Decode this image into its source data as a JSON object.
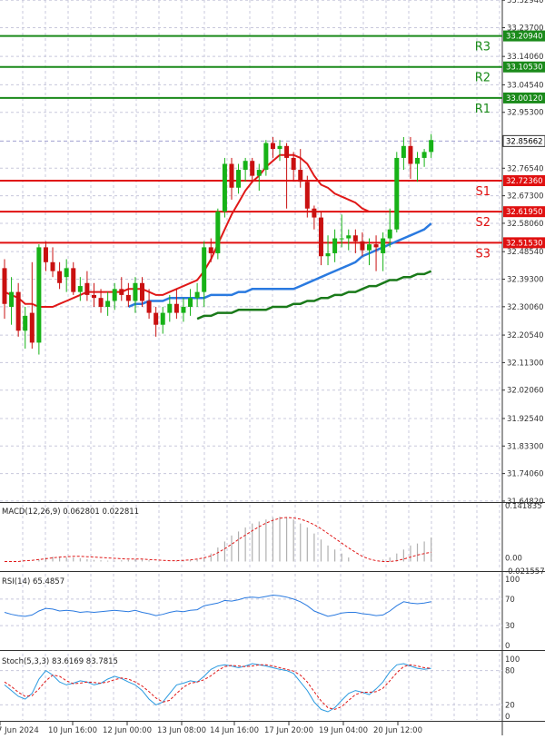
{
  "chart_data": {
    "type": "candlestick",
    "main": {
      "y_ticks": [
        "33.32940",
        "33.23700",
        "33.14060",
        "33.04540",
        "32.95300",
        "32.76540",
        "32.67300",
        "32.58060",
        "32.48540",
        "32.39300",
        "32.30060",
        "32.20540",
        "32.11300",
        "32.02060",
        "31.92540",
        "31.83300",
        "31.74060",
        "31.64820"
      ],
      "ylim": [
        31.648,
        33.33
      ],
      "current_price": "32.85662",
      "levels": [
        {
          "name": "R3",
          "value": 33.2094,
          "label": "33.20940",
          "color": "#1a8a1a"
        },
        {
          "name": "R2",
          "value": 33.1053,
          "label": "33.10530",
          "color": "#1a8a1a"
        },
        {
          "name": "R1",
          "value": 33.0012,
          "label": "33.00120",
          "color": "#1a8a1a"
        },
        {
          "name": "S1",
          "value": 32.7236,
          "label": "32.72360",
          "color": "#e01010"
        },
        {
          "name": "S2",
          "value": 32.6195,
          "label": "32.61950",
          "color": "#e01010"
        },
        {
          "name": "S3",
          "value": 32.5153,
          "label": "32.51530",
          "color": "#e01010"
        }
      ],
      "candles": [
        [
          32.43,
          32.46,
          32.26,
          32.31
        ],
        [
          32.3,
          32.4,
          32.24,
          32.35
        ],
        [
          32.35,
          32.38,
          32.2,
          32.22
        ],
        [
          32.22,
          32.3,
          32.16,
          32.27
        ],
        [
          32.28,
          32.45,
          32.16,
          32.18
        ],
        [
          32.18,
          32.51,
          32.14,
          32.5
        ],
        [
          32.5,
          32.52,
          32.42,
          32.45
        ],
        [
          32.45,
          32.5,
          32.4,
          32.42
        ],
        [
          32.42,
          32.45,
          32.36,
          32.38
        ],
        [
          32.4,
          32.46,
          32.35,
          32.43
        ],
        [
          32.43,
          32.45,
          32.34,
          32.35
        ],
        [
          32.35,
          32.4,
          32.32,
          32.37
        ],
        [
          32.38,
          32.42,
          32.32,
          32.34
        ],
        [
          32.34,
          32.38,
          32.3,
          32.33
        ],
        [
          32.33,
          32.36,
          32.28,
          32.3
        ],
        [
          32.3,
          32.35,
          32.27,
          32.32
        ],
        [
          32.32,
          32.38,
          32.29,
          32.36
        ],
        [
          32.36,
          32.4,
          32.32,
          32.34
        ],
        [
          32.34,
          32.38,
          32.3,
          32.32
        ],
        [
          32.32,
          32.4,
          32.28,
          32.38
        ],
        [
          32.38,
          32.4,
          32.3,
          32.32
        ],
        [
          32.32,
          32.36,
          32.26,
          32.28
        ],
        [
          32.28,
          32.3,
          32.2,
          32.24
        ],
        [
          32.24,
          32.3,
          32.21,
          32.28
        ],
        [
          32.28,
          32.34,
          32.25,
          32.31
        ],
        [
          32.31,
          32.36,
          32.26,
          32.28
        ],
        [
          32.28,
          32.33,
          32.25,
          32.3
        ],
        [
          32.3,
          32.36,
          32.27,
          32.33
        ],
        [
          32.33,
          32.38,
          32.3,
          32.35
        ],
        [
          32.35,
          32.52,
          32.3,
          32.5
        ],
        [
          32.5,
          32.53,
          32.45,
          32.48
        ],
        [
          32.48,
          32.63,
          32.46,
          32.62
        ],
        [
          32.62,
          32.8,
          32.6,
          32.78
        ],
        [
          32.78,
          32.8,
          32.66,
          32.7
        ],
        [
          32.7,
          32.78,
          32.68,
          32.76
        ],
        [
          32.76,
          32.8,
          32.72,
          32.79
        ],
        [
          32.79,
          32.8,
          32.72,
          32.74
        ],
        [
          32.74,
          32.78,
          32.69,
          32.76
        ],
        [
          32.76,
          32.86,
          32.74,
          32.85
        ],
        [
          32.85,
          32.87,
          32.8,
          32.83
        ],
        [
          32.83,
          32.86,
          32.79,
          32.84
        ],
        [
          32.84,
          32.85,
          32.63,
          32.8
        ],
        [
          32.8,
          32.82,
          32.72,
          32.76
        ],
        [
          32.76,
          32.83,
          32.7,
          32.72
        ],
        [
          32.72,
          32.74,
          32.6,
          32.63
        ],
        [
          32.63,
          32.64,
          32.56,
          32.6
        ],
        [
          32.6,
          32.62,
          32.44,
          32.47
        ],
        [
          32.47,
          32.54,
          32.44,
          32.48
        ],
        [
          32.48,
          32.56,
          32.45,
          32.53
        ],
        [
          32.53,
          32.61,
          32.5,
          32.53
        ],
        [
          32.53,
          32.56,
          32.49,
          32.54
        ],
        [
          32.54,
          32.56,
          32.48,
          32.52
        ],
        [
          32.52,
          32.55,
          32.47,
          32.49
        ],
        [
          32.49,
          32.53,
          32.44,
          32.51
        ],
        [
          32.51,
          32.54,
          32.42,
          32.5
        ],
        [
          32.48,
          32.55,
          32.42,
          32.53
        ],
        [
          32.53,
          32.63,
          32.5,
          32.56
        ],
        [
          32.56,
          32.82,
          32.55,
          32.8
        ],
        [
          32.8,
          32.87,
          32.76,
          32.84
        ],
        [
          32.84,
          32.87,
          32.73,
          32.78
        ],
        [
          32.78,
          32.82,
          32.72,
          32.8
        ],
        [
          32.8,
          32.83,
          32.77,
          32.82
        ],
        [
          32.82,
          32.88,
          32.8,
          32.86
        ]
      ],
      "ma_red": [
        32.35,
        32.34,
        32.33,
        32.31,
        32.31,
        32.3,
        32.3,
        32.3,
        32.31,
        32.32,
        32.33,
        32.34,
        32.35,
        32.35,
        32.35,
        32.35,
        32.35,
        32.35,
        32.36,
        32.36,
        32.36,
        32.35,
        32.34,
        32.34,
        32.35,
        32.36,
        32.37,
        32.38,
        32.39,
        32.42,
        32.46,
        32.51,
        32.56,
        32.61,
        32.65,
        32.69,
        32.72,
        32.74,
        32.77,
        32.79,
        32.81,
        32.81,
        32.81,
        32.8,
        32.78,
        32.74,
        32.71,
        32.7,
        32.68,
        32.67,
        32.66,
        32.65,
        32.63,
        32.62,
        32.62,
        32.62,
        32.62
      ],
      "ma_blue": [
        32.3,
        32.31,
        32.31,
        32.32,
        32.32,
        32.32,
        32.33,
        32.33,
        32.33,
        32.33,
        32.33,
        32.33,
        32.34,
        32.34,
        32.34,
        32.34,
        32.35,
        32.35,
        32.36,
        32.36,
        32.36,
        32.36,
        32.36,
        32.36,
        32.36,
        32.37,
        32.38,
        32.39,
        32.4,
        32.41,
        32.42,
        32.43,
        32.44,
        32.45,
        32.47,
        32.48,
        32.49,
        32.5,
        32.51,
        32.52,
        32.53,
        32.54,
        32.55,
        32.56,
        32.58
      ],
      "ma_green": [
        32.26,
        32.27,
        32.27,
        32.28,
        32.28,
        32.28,
        32.29,
        32.29,
        32.29,
        32.29,
        32.29,
        32.3,
        32.3,
        32.3,
        32.31,
        32.31,
        32.32,
        32.32,
        32.33,
        32.33,
        32.34,
        32.34,
        32.35,
        32.35,
        32.36,
        32.37,
        32.37,
        32.38,
        32.39,
        32.39,
        32.4,
        32.4,
        32.41,
        32.41,
        32.42
      ]
    },
    "x_labels": [
      "7 Jun 2024",
      "10 Jun 16:00",
      "12 Jun 00:00",
      "13 Jun 08:00",
      "14 Jun 16:00",
      "17 Jun 20:00",
      "19 Jun 04:00",
      "20 Jun 12:00"
    ],
    "macd": {
      "title": "MACD(12,26,9) 0.062801 0.022811",
      "y_ticks": [
        "0.141835",
        "0.00",
        "-0.021557"
      ],
      "ylim": [
        -0.0216,
        0.1418
      ],
      "histogram": [
        0.0,
        0.0,
        0.0,
        0.0,
        0.0,
        0.005,
        0.01,
        0.012,
        0.012,
        0.01,
        0.01,
        0.008,
        0.006,
        0.004,
        0.003,
        0.002,
        0.002,
        0.003,
        0.004,
        0.006,
        0.005,
        0.003,
        0.0,
        0.0,
        0.0,
        0.002,
        0.003,
        0.004,
        0.005,
        0.01,
        0.02,
        0.035,
        0.05,
        0.065,
        0.075,
        0.085,
        0.095,
        0.1,
        0.105,
        0.11,
        0.112,
        0.11,
        0.105,
        0.095,
        0.085,
        0.07,
        0.055,
        0.04,
        0.03,
        0.02,
        0.01,
        0.0,
        0.0,
        0.0,
        0.0,
        0.005,
        0.01,
        0.02,
        0.03,
        0.04,
        0.045,
        0.05,
        0.06
      ],
      "signal": [
        0.0,
        0.0,
        0.0,
        0.002,
        0.003,
        0.005,
        0.007,
        0.009,
        0.011,
        0.012,
        0.013,
        0.013,
        0.012,
        0.011,
        0.01,
        0.009,
        0.008,
        0.007,
        0.006,
        0.006,
        0.006,
        0.005,
        0.004,
        0.003,
        0.002,
        0.002,
        0.003,
        0.004,
        0.006,
        0.009,
        0.014,
        0.022,
        0.032,
        0.043,
        0.055,
        0.066,
        0.077,
        0.087,
        0.096,
        0.103,
        0.108,
        0.11,
        0.109,
        0.106,
        0.1,
        0.092,
        0.082,
        0.07,
        0.058,
        0.046,
        0.034,
        0.023,
        0.013,
        0.006,
        0.002,
        0.0,
        0.0,
        0.002,
        0.006,
        0.011,
        0.016,
        0.02,
        0.023
      ]
    },
    "rsi": {
      "title": "RSI(14) 65.4857",
      "y_ticks": [
        "100",
        "70",
        "30",
        "0"
      ],
      "ylim": [
        0,
        100
      ],
      "values": [
        50,
        47,
        45,
        44,
        46,
        52,
        56,
        55,
        52,
        53,
        52,
        50,
        51,
        50,
        51,
        52,
        53,
        52,
        51,
        53,
        50,
        48,
        45,
        47,
        50,
        52,
        51,
        53,
        54,
        60,
        62,
        64,
        68,
        67,
        69,
        72,
        73,
        72,
        74,
        76,
        75,
        73,
        70,
        66,
        60,
        52,
        48,
        44,
        46,
        49,
        50,
        50,
        48,
        47,
        45,
        46,
        52,
        60,
        66,
        64,
        63,
        64,
        66
      ]
    },
    "stoch": {
      "title": "Stoch(5,3,3) 83.6169 83.7815",
      "y_ticks": [
        "100",
        "80",
        "20",
        "0"
      ],
      "ylim": [
        0,
        100
      ],
      "k": [
        55,
        45,
        35,
        30,
        40,
        65,
        80,
        72,
        60,
        55,
        58,
        62,
        60,
        55,
        58,
        65,
        70,
        66,
        60,
        55,
        45,
        30,
        20,
        25,
        40,
        55,
        58,
        62,
        60,
        70,
        82,
        88,
        90,
        88,
        85,
        88,
        92,
        90,
        88,
        85,
        82,
        80,
        75,
        60,
        45,
        25,
        12,
        8,
        15,
        28,
        40,
        45,
        42,
        38,
        48,
        60,
        78,
        90,
        92,
        88,
        84,
        82,
        84
      ],
      "d": [
        60,
        52,
        42,
        35,
        36,
        48,
        62,
        72,
        70,
        62,
        57,
        58,
        60,
        59,
        58,
        60,
        64,
        67,
        65,
        60,
        53,
        43,
        32,
        25,
        28,
        40,
        51,
        58,
        60,
        64,
        71,
        80,
        87,
        89,
        88,
        87,
        88,
        90,
        90,
        88,
        85,
        82,
        79,
        72,
        60,
        43,
        27,
        15,
        12,
        17,
        28,
        38,
        42,
        42,
        43,
        49,
        62,
        76,
        87,
        90,
        88,
        85,
        84
      ]
    }
  }
}
